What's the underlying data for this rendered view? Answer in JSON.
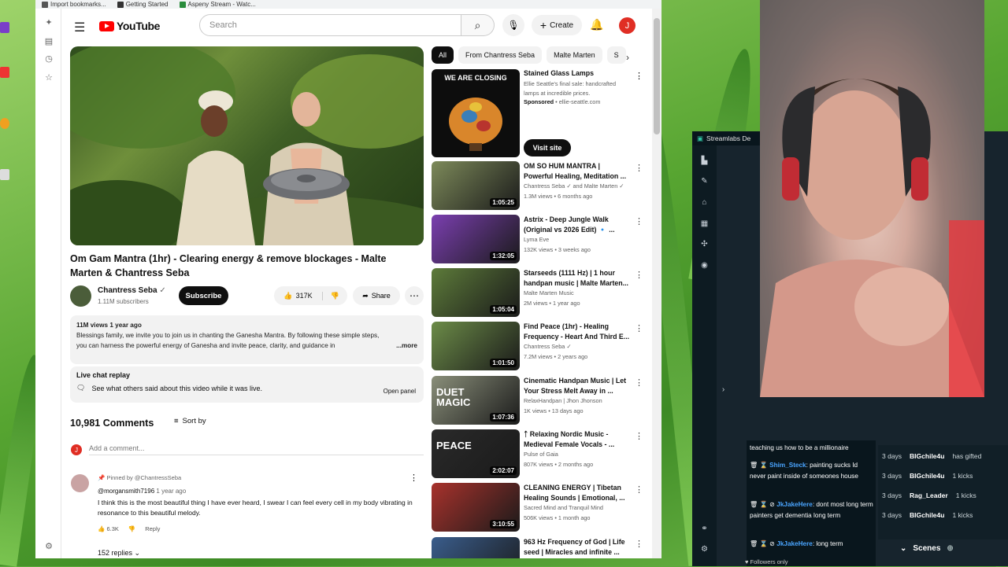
{
  "bookmarks": [
    "Import bookmarks...",
    "Getting Started",
    "Aspeny Stream - Watc..."
  ],
  "youtube": {
    "logo_text": "YouTube",
    "search_placeholder": "Search",
    "create_label": "Create",
    "avatar_letter": "J",
    "video": {
      "title": "Om Gam Mantra (1hr) - Clearing energy & remove blockages - Malte Marten & Chantress Seba",
      "channel": "Chantress Seba",
      "subscribers": "1.11M subscribers",
      "subscribe_label": "Subscribe",
      "likes": "317K",
      "share_label": "Share",
      "views_date": "11M views  1 year ago",
      "description": "Blessings family, we invite you to join us in chanting the Ganesha Mantra. By following these simple steps, you can harness the powerful energy of Ganesha and invite peace, clarity, and guidance in",
      "more_label": "...more"
    },
    "live_chat": {
      "title": "Live chat replay",
      "text": "See what others said about this video while it was live.",
      "open_label": "Open panel"
    },
    "comments": {
      "count": "10,981 Comments",
      "sort_label": "Sort by",
      "add_placeholder": "Add a comment...",
      "pinned_by": "Pinned by @ChantressSeba",
      "author": "@morgansmith7196",
      "author_time": "1 year ago",
      "text": "I think this is the most beautiful thing I have ever heard, I swear I can feel every cell in my body vibrating in resonance to this beautiful melody.",
      "likes": "6.3K",
      "reply_label": "Reply",
      "replies": "152 replies"
    },
    "chips": [
      "All",
      "From Chantress Seba",
      "Malte Marten",
      "S"
    ],
    "ad": {
      "thumb_heading": "WE ARE CLOSING",
      "title": "Stained Glass Lamps",
      "desc": "Ellie Seattle's final sale: handcrafted lamps at incredible prices.",
      "sponsored": "Sponsored",
      "domain": "ellie-seattle.com",
      "visit_label": "Visit site"
    },
    "recommendations": [
      {
        "title": "OM SO HUM MANTRA | Powerful Healing, Meditation ...",
        "channel": "Chantress Seba ✓ and Malte Marten ✓",
        "meta": "1.3M views • 6 months ago",
        "duration": "1:05:25",
        "color": "#7d8a5a"
      },
      {
        "title": "Astrix - Deep Jungle Walk (Original vs 2026 Edit) 🔹 ...",
        "channel": "Lyma Eve",
        "meta": "132K views • 3 weeks ago",
        "duration": "1:32:05",
        "color": "#7b3fb0"
      },
      {
        "title": "Starseeds (1111 Hz) | 1 hour handpan music | Malte Marten...",
        "channel": "Malte Marten Music",
        "meta": "2M views • 1 year ago",
        "duration": "1:05:04",
        "color": "#5d7b3a"
      },
      {
        "title": "Find Peace (1hr) - Healing Frequency - Heart And Third E...",
        "channel": "Chantress Seba ✓",
        "meta": "7.2M views • 2 years ago",
        "duration": "1:01:50",
        "color": "#6c8c48"
      },
      {
        "title": "Cinematic Handpan Music | Let Your Stress Melt Away in ...",
        "channel": "RelaxHandpan | Jhon Jhonson",
        "meta": "1K views • 13 days ago",
        "duration": "1:07:36",
        "color": "#8a8f7a",
        "thumb_text": "DUET MAGIC"
      },
      {
        "title": "ᛏ Relaxing Nordic Music - Medieval Female Vocals - ...",
        "channel": "Pulse of Gaia",
        "meta": "807K views • 2 months ago",
        "duration": "2:02:07",
        "color": "#2a2a2a",
        "thumb_text": "PEACE"
      },
      {
        "title": "CLEANING ENERGY | Tibetan Healing Sounds | Emotional, ...",
        "channel": "Sacred Mind and Tranquil Mind",
        "meta": "506K views • 1 month ago",
        "duration": "3:10:55",
        "color": "#a8322c"
      },
      {
        "title": "963 Hz Frequency of God | Life seed | Miracles and infinite ...",
        "channel": "",
        "meta": "",
        "duration": "",
        "color": "#3a5d8c"
      }
    ]
  },
  "streamlabs": {
    "title": "Streamlabs De",
    "chat": [
      {
        "user": "",
        "text": "teaching us how to be a millionaire"
      },
      {
        "user": "Shim_Steck",
        "text": ": painting sucks Id never paint inside of someones house"
      },
      {
        "user": "JkJakeHere",
        "text": ": dont most long term painters get dementia long term"
      },
      {
        "user": "JkJakeHere",
        "text": ": long term"
      }
    ],
    "events": [
      {
        "time": "3 days",
        "name": "BIGchile4u",
        "action": "has gifted"
      },
      {
        "time": "3 days",
        "name": "BIGchile4u",
        "action": "1 kicks"
      },
      {
        "time": "3 days",
        "name": "Rag_Leader",
        "action": "1 kicks"
      },
      {
        "time": "3 days",
        "name": "BIGchile4u",
        "action": "1 kicks"
      }
    ],
    "scenes_label": "Scenes",
    "followers_label": "Followers only"
  }
}
